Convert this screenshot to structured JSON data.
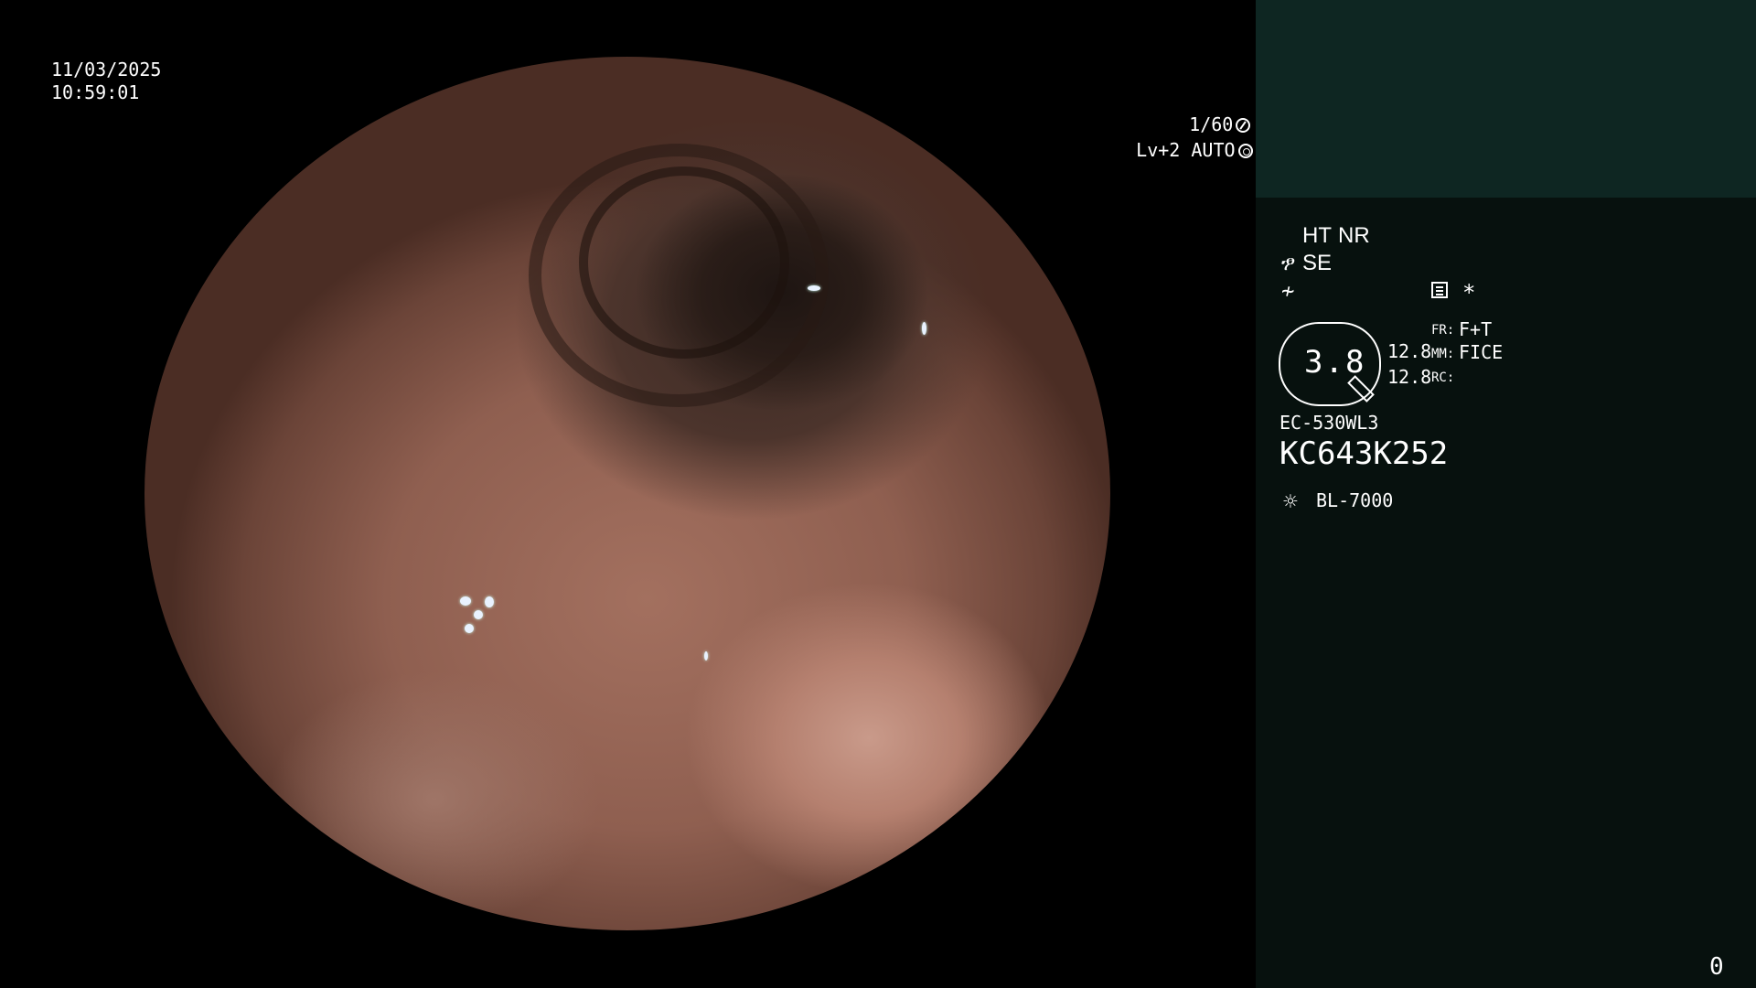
{
  "overlay": {
    "date": "11/03/2025",
    "time": "10:59:01",
    "shutter": "1/60",
    "shutter_icon": "aperture-icon",
    "level": "Lv+2 AUTO",
    "level_icon": "iris-icon"
  },
  "panel": {
    "ht": "HT",
    "nr": "NR",
    "se": "SE",
    "se_icon": "structure-enhance-icon",
    "contrast_icon": "contrast-icon",
    "menu_icon": "settings-list-icon",
    "asterisk": "*",
    "zoom_value": "3.8",
    "zoom_icon": "magnifier-icon",
    "val1": "12.8",
    "val2": "12.8",
    "fr_label": "FR:",
    "fr_value": "F+T",
    "mm_label": "MM:",
    "mm_value": "FICE",
    "rc_label": "RC:",
    "rc_value": "",
    "scope_model": "EC-530WL3",
    "scope_serial": "KC643K252",
    "light_icon": "light-source-icon",
    "light_source": "BL-7000",
    "counter": "0"
  },
  "colors": {
    "panel_bg": "#07110e",
    "panel_top_bg": "#0e2622",
    "accent_green": "#6ff05e"
  }
}
